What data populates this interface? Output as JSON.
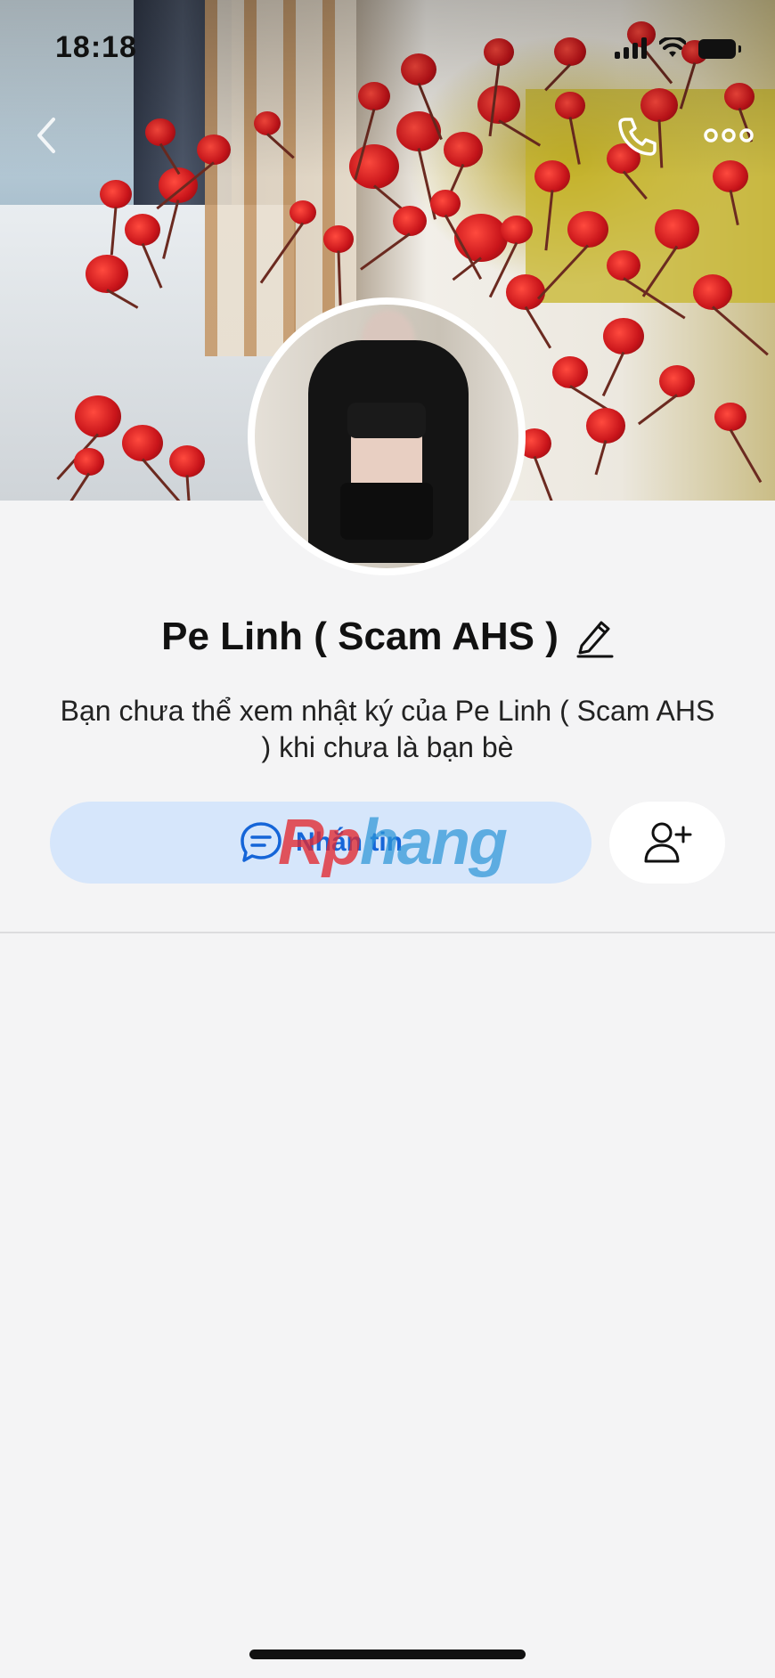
{
  "status_bar": {
    "time": "18:18",
    "icons": [
      "cellular-signal-icon",
      "wifi-icon",
      "battery-icon"
    ]
  },
  "navigation": {
    "back_icon": "chevron-left-icon",
    "call_icon": "phone-icon",
    "more_icon": "more-dots-icon"
  },
  "profile": {
    "name": "Pe Linh ( Scam AHS )",
    "edit_icon": "pencil-icon",
    "notice": "Bạn chưa thể xem nhật ký của Pe Linh ( Scam AHS ) khi chưa là bạn bè"
  },
  "actions": {
    "message_label": "Nhắn tin",
    "message_icon": "chat-bubble-icon",
    "add_friend_icon": "add-friend-icon"
  },
  "watermark": {
    "part1": "Rp",
    "part2": "hang"
  },
  "colors": {
    "background": "#f4f4f5",
    "message_button_bg": "#d6e6fb",
    "message_text": "#1565d8",
    "watermark_red": "#e22830",
    "watermark_blue": "#2d96d7"
  }
}
